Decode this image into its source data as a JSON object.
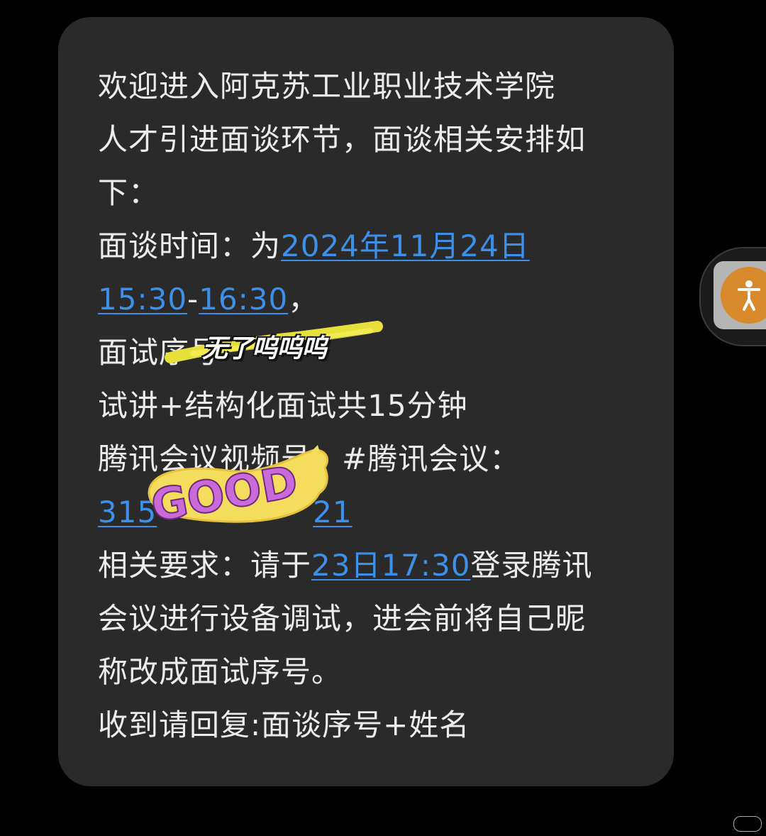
{
  "message": {
    "line1": "欢迎进入阿克苏工业职业技术学院",
    "line2": "人才引进面谈环节，面谈相关安排如",
    "line3": "下：",
    "line4_prefix": "面谈时间：为",
    "line4_date": "2024年11月24日",
    "line5_start": "15:30",
    "line5_dash": "-",
    "line5_end": "16:30",
    "line5_suffix": "，",
    "line6": "面试序号",
    "line7": "试讲+结构化面试共15分钟",
    "line8": "腾讯会议视频号：#腾讯会议：",
    "line9_start": "315",
    "line9_end": "21",
    "line10_prefix": "相关要求：请于",
    "line10_time": "23日17:30",
    "line10_suffix": "登录腾讯",
    "line11": "会议进行设备调试，进会前将自己昵",
    "line12": "称改成面试序号。",
    "line13": "收到请回复:面谈序号+姓名"
  },
  "sticker": {
    "caption": "无了呜呜呜",
    "good_text": "GOOD"
  },
  "colors": {
    "bubble": "#2a2a2a",
    "text": "#ececec",
    "link": "#3d8fe8",
    "highlighter": "#e8e03a",
    "accessibility_button": "#d8892c"
  },
  "icons": {
    "floating": "accessibility-icon"
  }
}
